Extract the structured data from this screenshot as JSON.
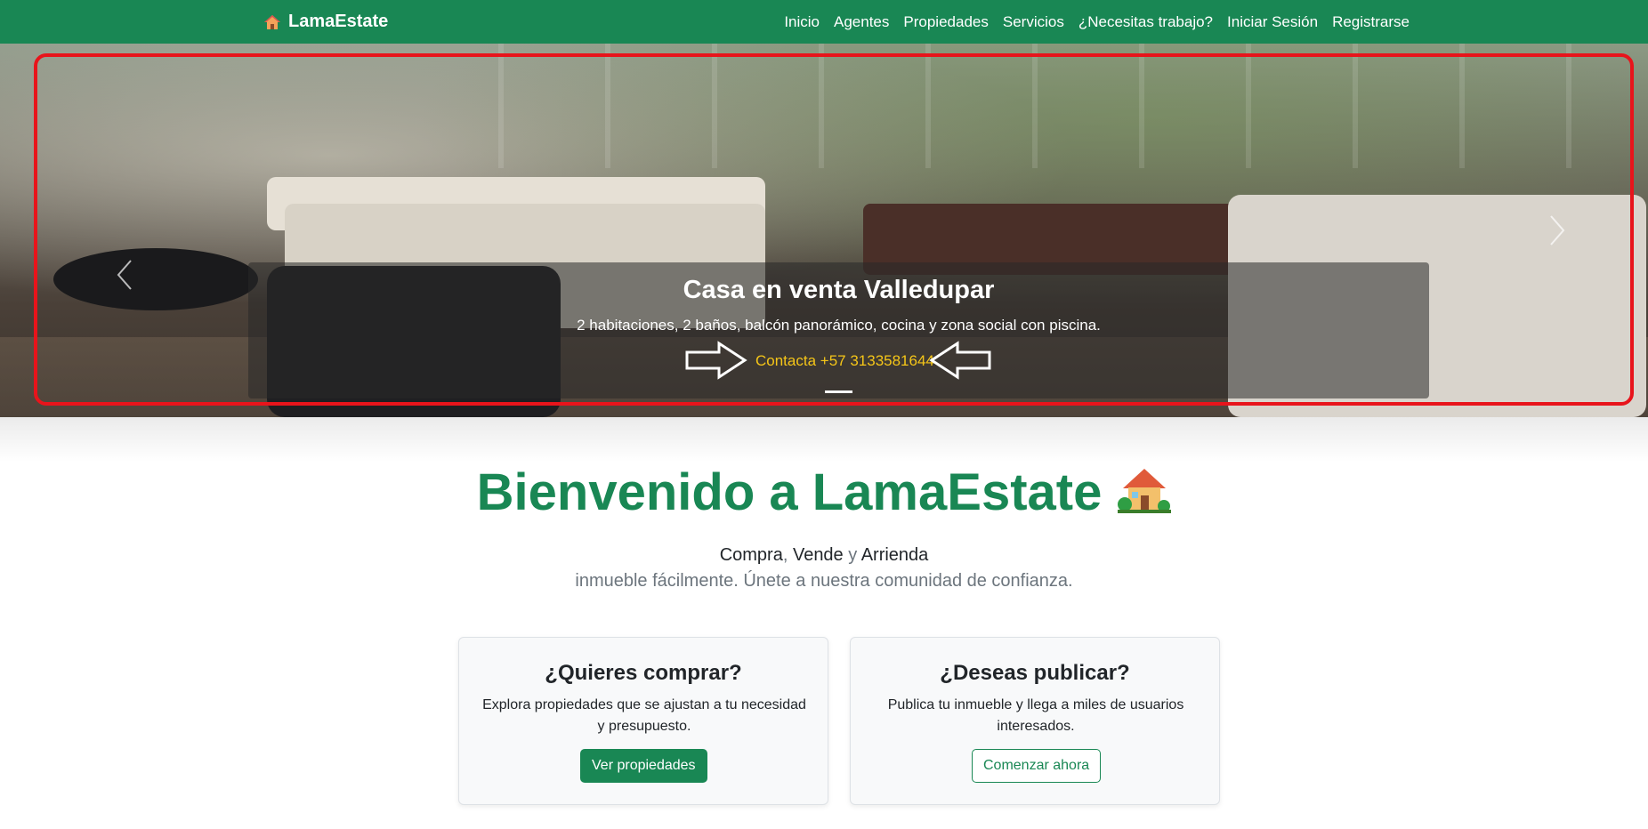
{
  "navbar": {
    "brand_icon": "house-icon",
    "brand": "LamaEstate",
    "links": [
      "Inicio",
      "Agentes",
      "Propiedades",
      "Servicios",
      "¿Necesitas trabajo?",
      "Iniciar Sesión",
      "Registrarse"
    ]
  },
  "hero": {
    "title": "Casa en venta Valledupar",
    "description": "2 habitaciones, 2 baños, balcón panorámico, cocina y zona social con piscina.",
    "contact": "Contacta +57 3133581644",
    "highlight_color": "#e8141b",
    "contact_color": "#f5c518"
  },
  "welcome": {
    "title": "Bienvenido a LamaEstate",
    "tagline_parts": [
      "Compra",
      ", ",
      "Vende",
      " y ",
      "Arrienda"
    ],
    "subtagline": "inmueble fácilmente. Únete a nuestra comunidad de confianza."
  },
  "cards": {
    "buy": {
      "title": "¿Quieres comprar?",
      "text": "Explora propiedades que se ajustan a tu necesidad y presupuesto.",
      "button": "Ver propiedades"
    },
    "publish": {
      "title": "¿Deseas publicar?",
      "text": "Publica tu inmueble y llega a miles de usuarios interesados.",
      "button": "Comenzar ahora"
    }
  },
  "colors": {
    "brand_green": "#198754",
    "muted": "#6c757d"
  }
}
